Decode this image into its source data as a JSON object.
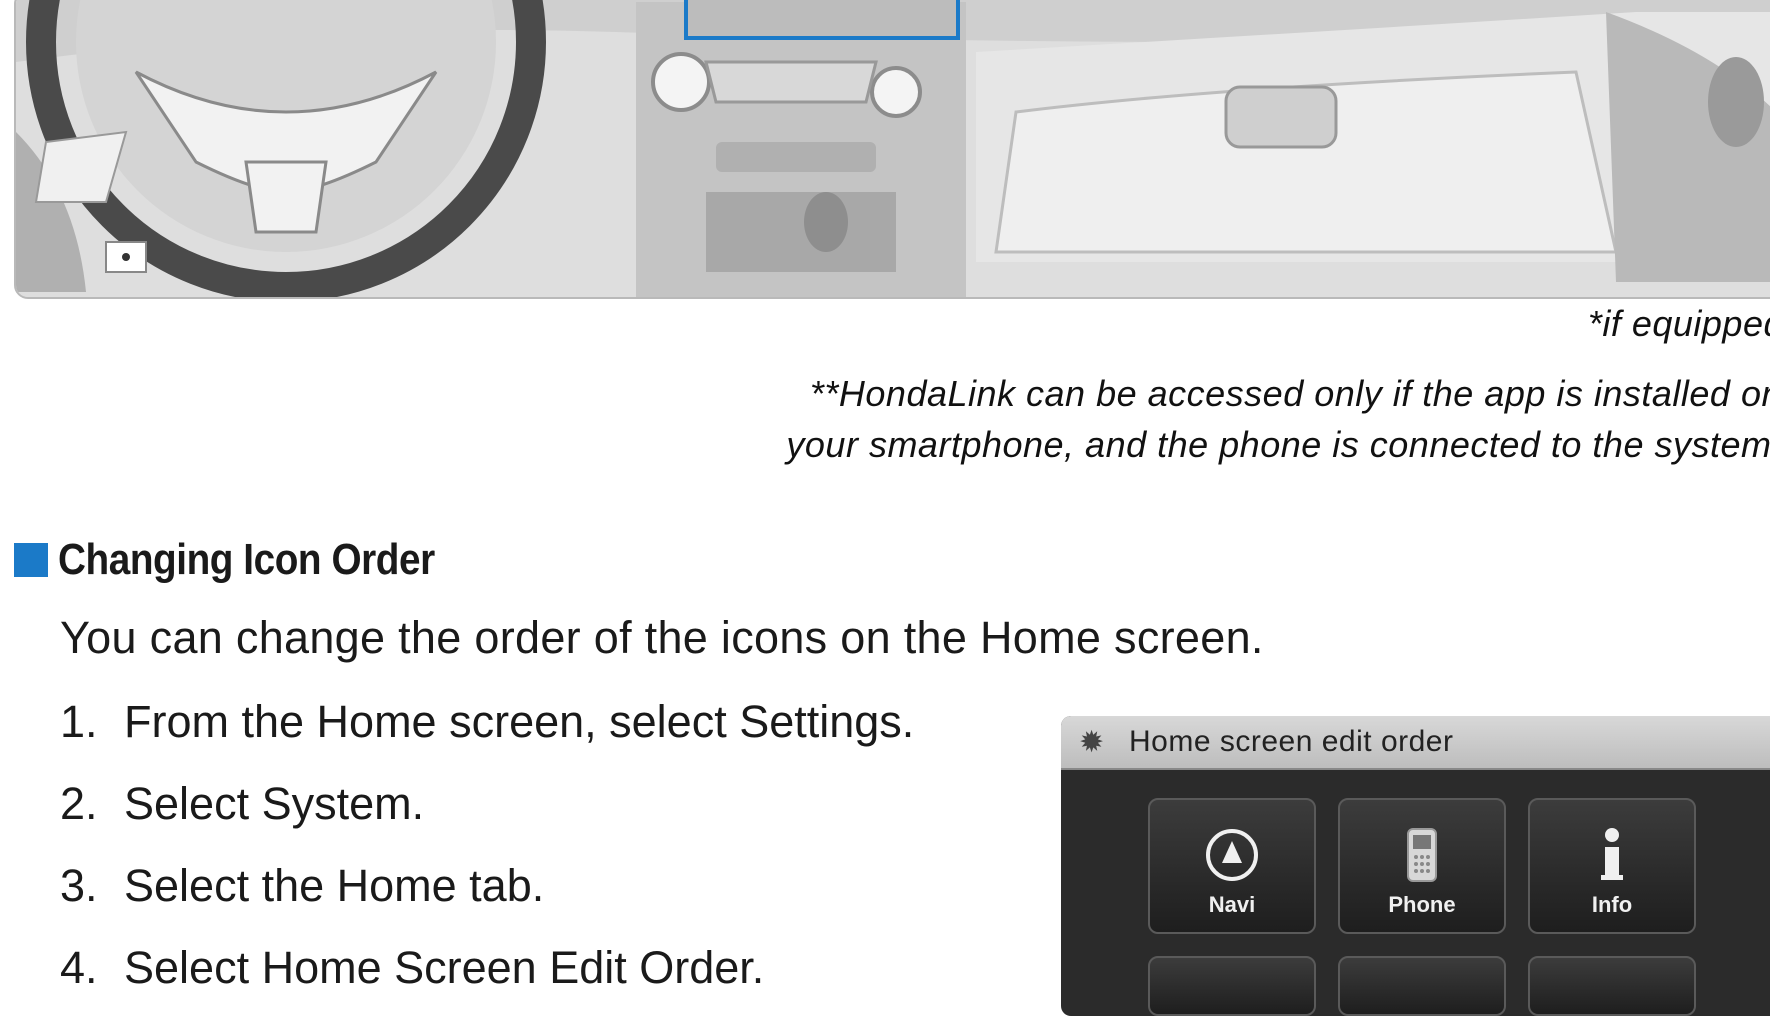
{
  "footnotes": {
    "if_equipped": "*if equipped",
    "hondalink_line1": "**HondaLink can be accessed only if the app is installed on",
    "hondalink_line2": "your smartphone, and the phone is connected to the system."
  },
  "section": {
    "title": "Changing Icon Order",
    "intro": "You can change the order of the icons on the Home screen.",
    "accent_color": "#1b7ac8",
    "steps": [
      {
        "num": "1.",
        "text": "From the Home screen, select Settings."
      },
      {
        "num": "2.",
        "text": "Select System."
      },
      {
        "num": "3.",
        "text": "Select the Home tab."
      },
      {
        "num": "4.",
        "text": "Select Home Screen Edit Order."
      }
    ]
  },
  "screen": {
    "title": "Home screen edit order",
    "tiles": [
      {
        "label": "Navi",
        "icon": "navi-icon"
      },
      {
        "label": "Phone",
        "icon": "phone-icon"
      },
      {
        "label": "Info",
        "icon": "info-icon"
      }
    ]
  }
}
